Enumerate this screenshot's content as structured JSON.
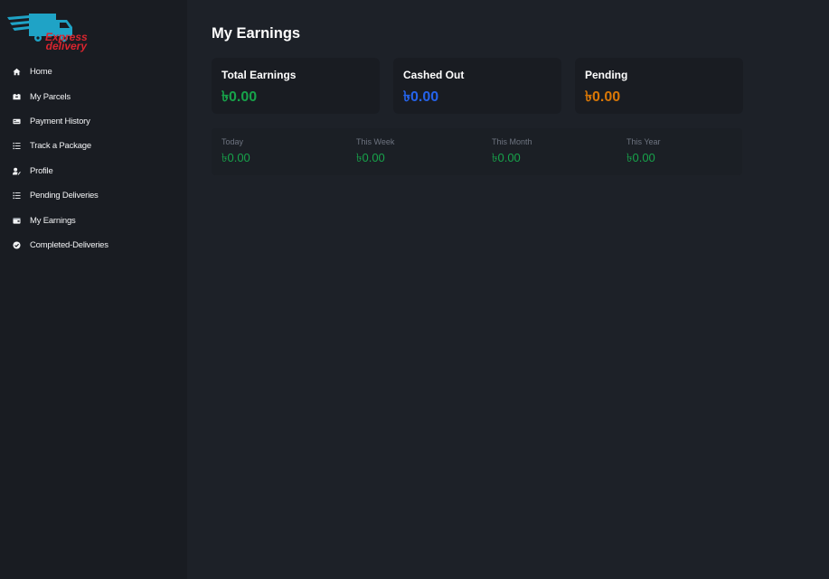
{
  "brand": {
    "line1": "Express",
    "line2": "delivery",
    "colors": {
      "truck": "#1fa3c6",
      "text": "#d9252f"
    }
  },
  "sidebar": {
    "items": [
      {
        "label": "Home",
        "icon": "home-icon"
      },
      {
        "label": "My Parcels",
        "icon": "parcel-icon"
      },
      {
        "label": "Payment History",
        "icon": "payment-icon"
      },
      {
        "label": "Track a Package",
        "icon": "list-icon"
      },
      {
        "label": "Profile",
        "icon": "user-edit-icon"
      },
      {
        "label": "Pending Deliveries",
        "icon": "list-icon"
      },
      {
        "label": "My Earnings",
        "icon": "wallet-icon"
      },
      {
        "label": "Completed-Deliveries",
        "icon": "check-circle-icon"
      }
    ]
  },
  "main": {
    "title": "My Earnings",
    "cards": [
      {
        "label": "Total Earnings",
        "value": "৳0.00",
        "color": "#17a34a"
      },
      {
        "label": "Cashed Out",
        "value": "৳0.00",
        "color": "#2563eb"
      },
      {
        "label": "Pending",
        "value": "৳0.00",
        "color": "#d97706"
      }
    ],
    "periods": [
      {
        "label": "Today",
        "value": "৳0.00"
      },
      {
        "label": "This Week",
        "value": "৳0.00"
      },
      {
        "label": "This Month",
        "value": "৳0.00"
      },
      {
        "label": "This Year",
        "value": "৳0.00"
      }
    ],
    "period_value_color": "#17a34a"
  }
}
